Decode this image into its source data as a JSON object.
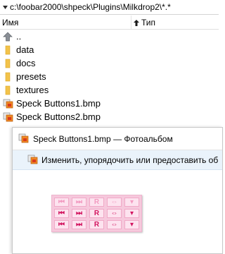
{
  "path": {
    "text": "c:\\foobar2000\\shpeck\\Plugins\\Milkdrop2\\*.*"
  },
  "columns": {
    "name": "Имя",
    "type": "Тип"
  },
  "files": [
    {
      "icon": "up-arrow-icon",
      "label": ".."
    },
    {
      "icon": "folder-icon",
      "label": "data"
    },
    {
      "icon": "folder-icon",
      "label": "docs"
    },
    {
      "icon": "folder-icon",
      "label": "presets"
    },
    {
      "icon": "folder-icon",
      "label": "textures"
    },
    {
      "icon": "bmp-image-icon",
      "label": "Speck Buttons1.bmp"
    },
    {
      "icon": "bmp-image-icon",
      "label": "Speck Buttons2.bmp"
    }
  ],
  "photo_window": {
    "title": "Speck Buttons1.bmp — Фотоальбом",
    "toolbar_text": "Изменить, упорядочить или предоставить об"
  },
  "sprite": {
    "rows": [
      [
        "⏮",
        "⏭",
        "R",
        "⇔",
        "▾"
      ],
      [
        "⏮",
        "⏭",
        "R",
        "⇔",
        "▾"
      ],
      [
        "⏮",
        "⏭",
        "R",
        "⇔",
        "▾"
      ]
    ],
    "colors": {
      "faded": "#f29ac0",
      "active": "#d2145f",
      "background": "#f6c8dc"
    }
  }
}
